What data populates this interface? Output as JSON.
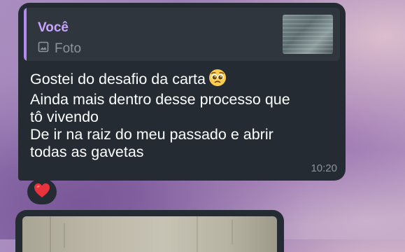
{
  "reply": {
    "sender": "Você",
    "media_label": "Foto",
    "media_icon": "image-icon",
    "accent_color": "#b489f0"
  },
  "message": {
    "lines": [
      "Gostei do desafio da carta",
      "Ainda mais dentro desse processo que",
      "tô vivendo",
      "De ir na raiz do meu passado e abrir",
      "todas as gavetas"
    ],
    "emoji": "pleading-face-emoji",
    "time": "10:20"
  },
  "reaction": {
    "emoji": "red-heart-emoji"
  },
  "next_message": {
    "type": "photo"
  },
  "colors": {
    "bubble": "#242b32",
    "reply_background": "#2f363e",
    "sender_name": "#c9a4ff",
    "text": "#ffffff",
    "meta": "#8b939c"
  }
}
